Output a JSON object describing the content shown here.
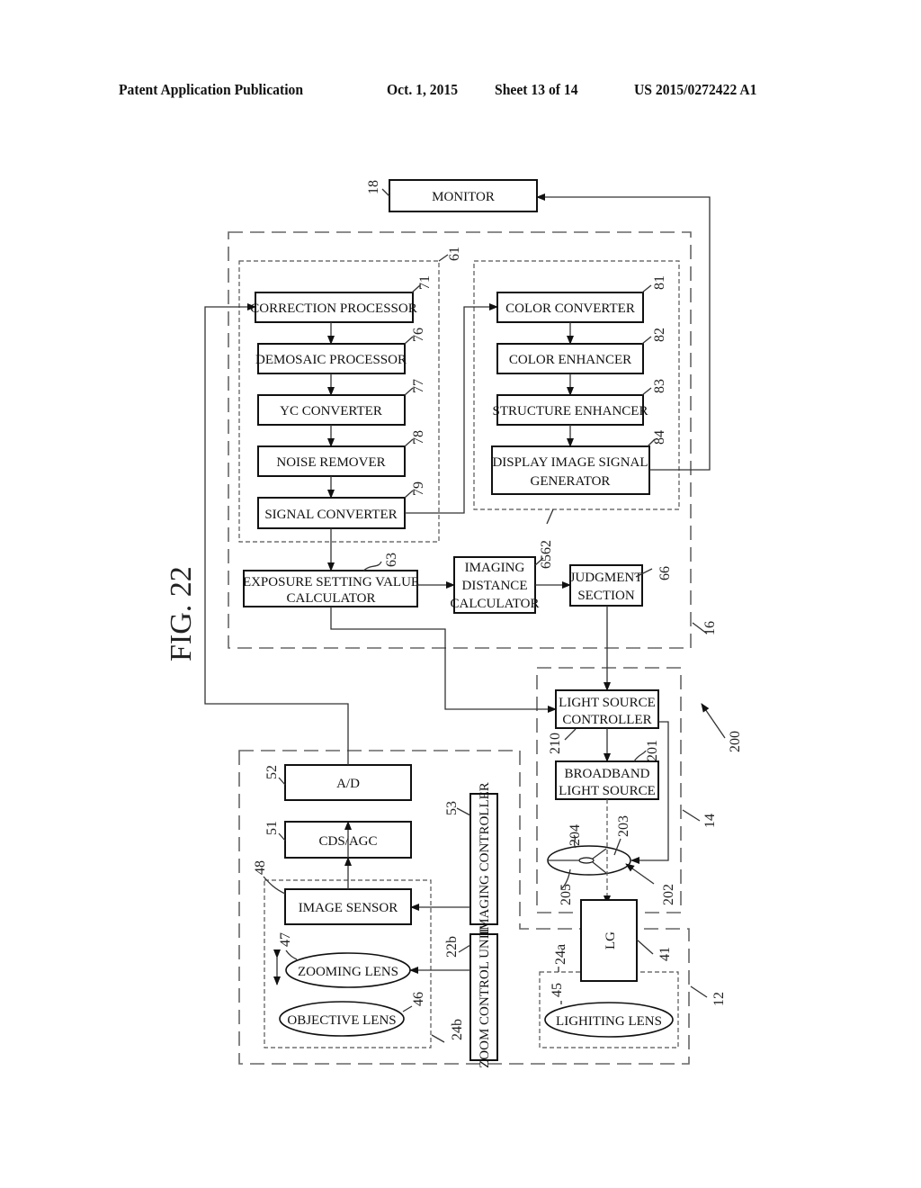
{
  "header": {
    "publication": "Patent Application Publication",
    "date": "Oct. 1, 2015",
    "sheet": "Sheet 13 of 14",
    "number": "US 2015/0272422 A1"
  },
  "figure": {
    "label": "FIG. 22"
  },
  "blocks": {
    "monitor": {
      "ref": "18",
      "line1": "MONITOR"
    },
    "correction_processor": {
      "ref": "71",
      "line1": "CORRECTION PROCESSOR"
    },
    "demosaic_processor": {
      "ref": "76",
      "line1": "DEMOSAIC PROCESSOR"
    },
    "yc_converter": {
      "ref": "77",
      "line1": "YC CONVERTER"
    },
    "noise_remover": {
      "ref": "78",
      "line1": "NOISE REMOVER"
    },
    "signal_converter": {
      "ref": "79",
      "line1": "SIGNAL CONVERTER"
    },
    "color_converter": {
      "ref": "81",
      "line1": "COLOR CONVERTER"
    },
    "color_enhancer": {
      "ref": "82",
      "line1": "COLOR ENHANCER"
    },
    "structure_enhancer": {
      "ref": "83",
      "line1": "STRUCTURE ENHANCER"
    },
    "display_image_signal_generator": {
      "ref": "84",
      "line1": "DISPLAY IMAGE SIGNAL",
      "line2": "GENERATOR"
    },
    "exposure_setting_value_calculator": {
      "ref": "63",
      "line1": "EXPOSURE SETTING VALUE",
      "line2": "CALCULATOR"
    },
    "imaging_distance_calculator": {
      "ref": "65",
      "line1": "IMAGING",
      "line2": "DISTANCE",
      "line3": "CALCULATOR"
    },
    "judgment_section": {
      "ref": "66",
      "line1": "JUDGMENT",
      "line2": "SECTION"
    },
    "light_source_controller": {
      "ref": "210",
      "line1": "LIGHT SOURCE",
      "line2": "CONTROLLER"
    },
    "broadband_light_source": {
      "ref": "201",
      "line1": "BROADBAND",
      "line2": "LIGHT SOURCE"
    },
    "ad": {
      "ref": "52",
      "line1": "A/D"
    },
    "cds_agc": {
      "ref": "51",
      "line1": "CDS/AGC"
    },
    "image_sensor": {
      "ref": "48",
      "line1": "IMAGE SENSOR"
    },
    "imaging_controller": {
      "ref": "53",
      "line1": "IMAGING CONTROLLER"
    },
    "zoom_control_unit": {
      "ref": "22b",
      "line1": "ZOOM CONTROL UNIT"
    },
    "zooming_lens": {
      "ref": "47",
      "line1": "ZOOMING LENS"
    },
    "objective_lens": {
      "ref": "46",
      "line1": "OBJECTIVE LENS"
    },
    "lighting_lens": {
      "ref": "45",
      "line1": "LIGHITING LENS"
    },
    "light_guide": {
      "ref": "41",
      "line1": "LG"
    }
  },
  "groups": {
    "processor_device": "16",
    "image_processing_1": "61",
    "image_processing_2": "62",
    "light_source_device": "14",
    "endoscope": "12",
    "imaging_unit": "24b",
    "lighting_unit": "24a",
    "light_source_assembly": "200",
    "rotary_filter": "202",
    "filter_segment_203": "203",
    "filter_segment_204": "204",
    "filter_segment_205": "205"
  }
}
